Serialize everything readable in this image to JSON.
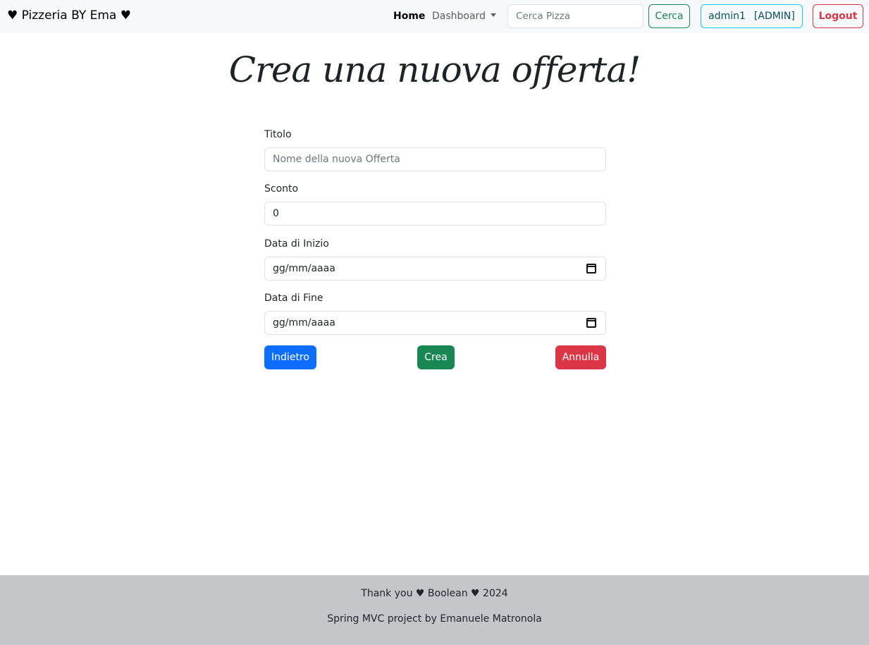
{
  "navbar": {
    "brand": "♥ Pizzeria BY Ema ♥",
    "home_label": "Home",
    "dashboard_label": "Dashboard",
    "search_placeholder": "Cerca Pizza",
    "search_button": "Cerca",
    "user_name": "admin1",
    "user_role": "[ADMIN]",
    "logout_label": "Logout"
  },
  "page": {
    "title": "Crea una nuova offerta!"
  },
  "form": {
    "title_label": "Titolo",
    "title_placeholder": "Nome della nuova Offerta",
    "title_value": "",
    "discount_label": "Sconto",
    "discount_value": "0",
    "start_label": "Data di Inizio",
    "start_value": "gg/mm/aaaa",
    "end_label": "Data di Fine",
    "end_value": "gg/mm/aaaa",
    "back_button": "Indietro",
    "create_button": "Crea",
    "cancel_button": "Annulla"
  },
  "footer": {
    "line1": "Thank you ♥ Boolean ♥ 2024",
    "line2": "Spring MVC project by Emanuele Matronola"
  },
  "colors": {
    "primary": "#0d6efd",
    "success": "#198754",
    "danger": "#dc3545",
    "info": "#0dcaf0",
    "navbar_bg": "#f8f9fa",
    "footer_bg": "#c4c6c9"
  },
  "icons": {
    "date_picker": "calendar-icon",
    "dropdown": "chevron-down-icon"
  }
}
